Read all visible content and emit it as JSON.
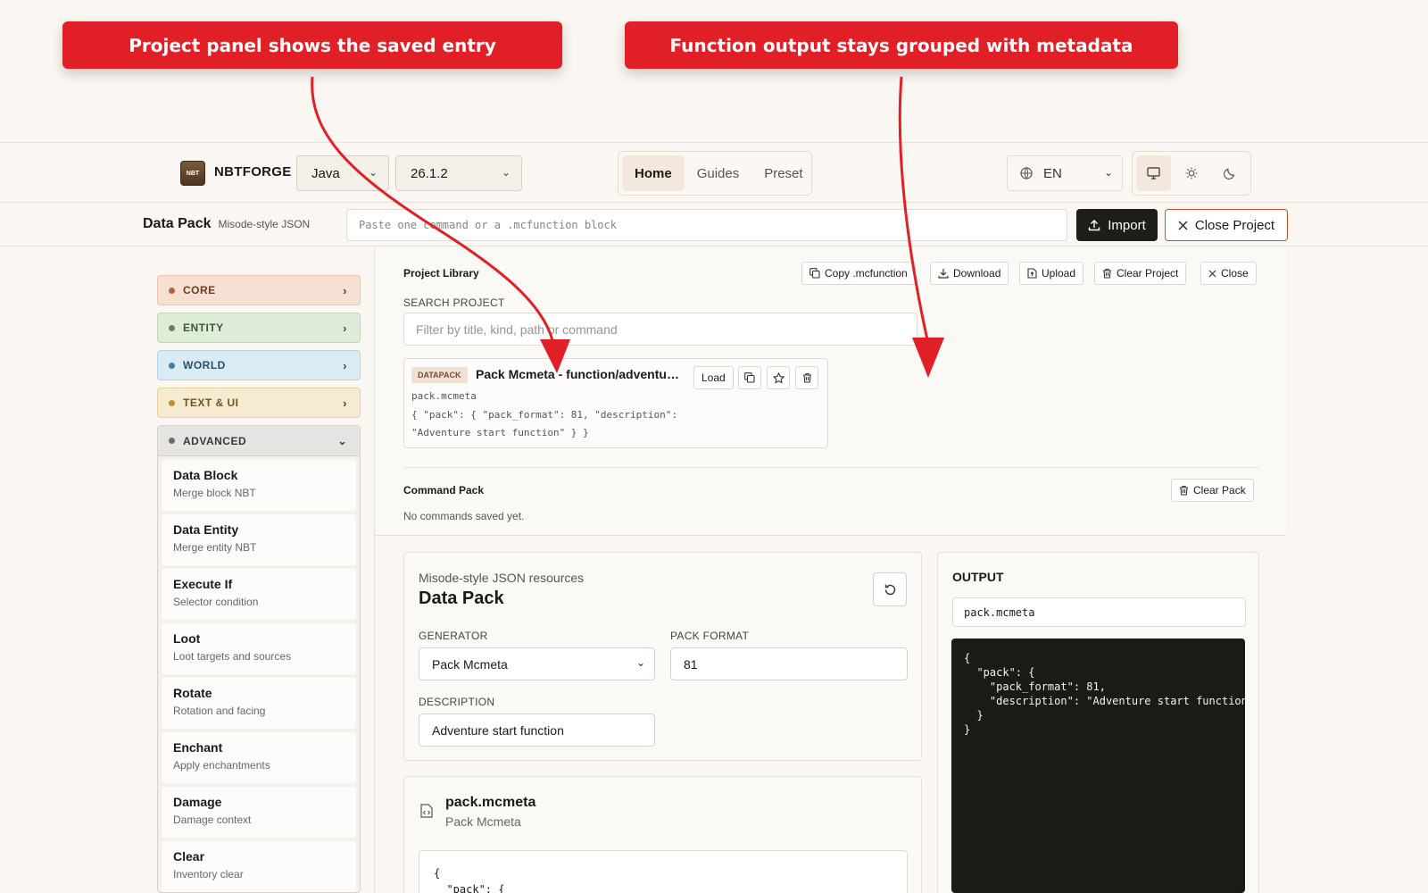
{
  "annotations": {
    "left": "Project panel shows the saved entry",
    "right": "Function output stays grouped with metadata"
  },
  "header": {
    "brand": "NBTFORGE",
    "logo_text": "NBT",
    "edition": "Java",
    "version": "26.1.2",
    "nav": [
      "Home",
      "Guides",
      "Preset"
    ],
    "language": "EN"
  },
  "subbar": {
    "title": "Data Pack",
    "subtitle": "Misode-style JSON",
    "command_placeholder": "Paste one command or a .mcfunction block",
    "import_label": "Import",
    "close_project_label": "Close Project"
  },
  "sidebar": {
    "categories": [
      "CORE",
      "ENTITY",
      "WORLD",
      "TEXT & UI"
    ],
    "advanced": {
      "label": "ADVANCED",
      "items": [
        {
          "title": "Data Block",
          "desc": "Merge block NBT"
        },
        {
          "title": "Data Entity",
          "desc": "Merge entity NBT"
        },
        {
          "title": "Execute If",
          "desc": "Selector condition"
        },
        {
          "title": "Loot",
          "desc": "Loot targets and sources"
        },
        {
          "title": "Rotate",
          "desc": "Rotation and facing"
        },
        {
          "title": "Enchant",
          "desc": "Apply enchantments"
        },
        {
          "title": "Damage",
          "desc": "Damage context"
        },
        {
          "title": "Clear",
          "desc": "Inventory clear"
        }
      ]
    }
  },
  "library": {
    "title": "Project Library",
    "actions": [
      "Copy .mcfunction",
      "Download",
      "Upload",
      "Clear Project",
      "Close"
    ],
    "search_label": "SEARCH PROJECT",
    "search_placeholder": "Filter by title, kind, path or command",
    "entry": {
      "badge": "DATAPACK",
      "title": "Pack Mcmeta - function/adventure_start",
      "load_label": "Load",
      "path": "pack.mcmeta",
      "code_line1": "{ \"pack\": { \"pack_format\": 81, \"description\":",
      "code_line2": "\"Adventure start function\" } }"
    },
    "command_pack_title": "Command Pack",
    "clear_pack_label": "Clear Pack",
    "empty_text": "No commands saved yet."
  },
  "generator": {
    "eyebrow": "Misode-style JSON resources",
    "title": "Data Pack",
    "generator_label": "GENERATOR",
    "generator_value": "Pack Mcmeta",
    "pack_format_label": "PACK FORMAT",
    "pack_format_value": "81",
    "description_label": "DESCRIPTION",
    "description_value": "Adventure start function"
  },
  "file_card": {
    "title": "pack.mcmeta",
    "subtitle": "Pack Mcmeta",
    "code_line1": "{",
    "code_line2": "  \"pack\": {"
  },
  "output": {
    "label": "OUTPUT",
    "filename": "pack.mcmeta",
    "code": "{\n  \"pack\": {\n    \"pack_format\": 81,\n    \"description\": \"Adventure start function\"\n  }\n}"
  }
}
